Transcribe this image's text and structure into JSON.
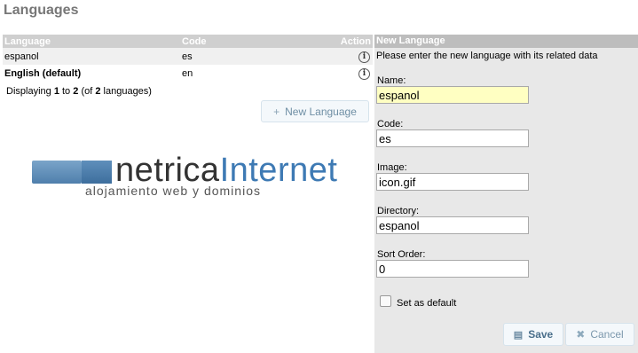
{
  "page_title": "Languages",
  "listing": {
    "columns": {
      "language": "Language",
      "code": "Code",
      "action": "Action"
    },
    "rows": [
      {
        "language": "espanol",
        "code": "es",
        "bold": false
      },
      {
        "language": "English (default)",
        "code": "en",
        "bold": true
      }
    ],
    "count": {
      "prefix": "Displaying",
      "from": "1",
      "to_word": "to",
      "to": "2",
      "of_open": "(of",
      "total": "2",
      "suffix": "languages)"
    },
    "new_button": "New Language"
  },
  "logo": {
    "word1": "netrica",
    "word2": "Internet",
    "tagline": "alojamiento web y dominios"
  },
  "panel": {
    "title": "New Language",
    "intro": "Please enter the new language with its related data",
    "fields": {
      "name": {
        "label": "Name:",
        "value": "espanol"
      },
      "code": {
        "label": "Code:",
        "value": "es"
      },
      "image": {
        "label": "Image:",
        "value": "icon.gif"
      },
      "directory": {
        "label": "Directory:",
        "value": "espanol"
      },
      "sort_order": {
        "label": "Sort Order:",
        "value": "0"
      }
    },
    "default_label": "Set as default",
    "save": "Save",
    "cancel": "Cancel"
  },
  "icons": {
    "info": "info-icon",
    "plus": "plus-icon",
    "save": "save-icon",
    "cancel": "cancel-icon"
  },
  "colors": {
    "header": "#cfcfcf",
    "panel_bg": "#e8e8e8",
    "focused_field": "#ffffc2",
    "brand_blue": "#3e7ab4"
  }
}
